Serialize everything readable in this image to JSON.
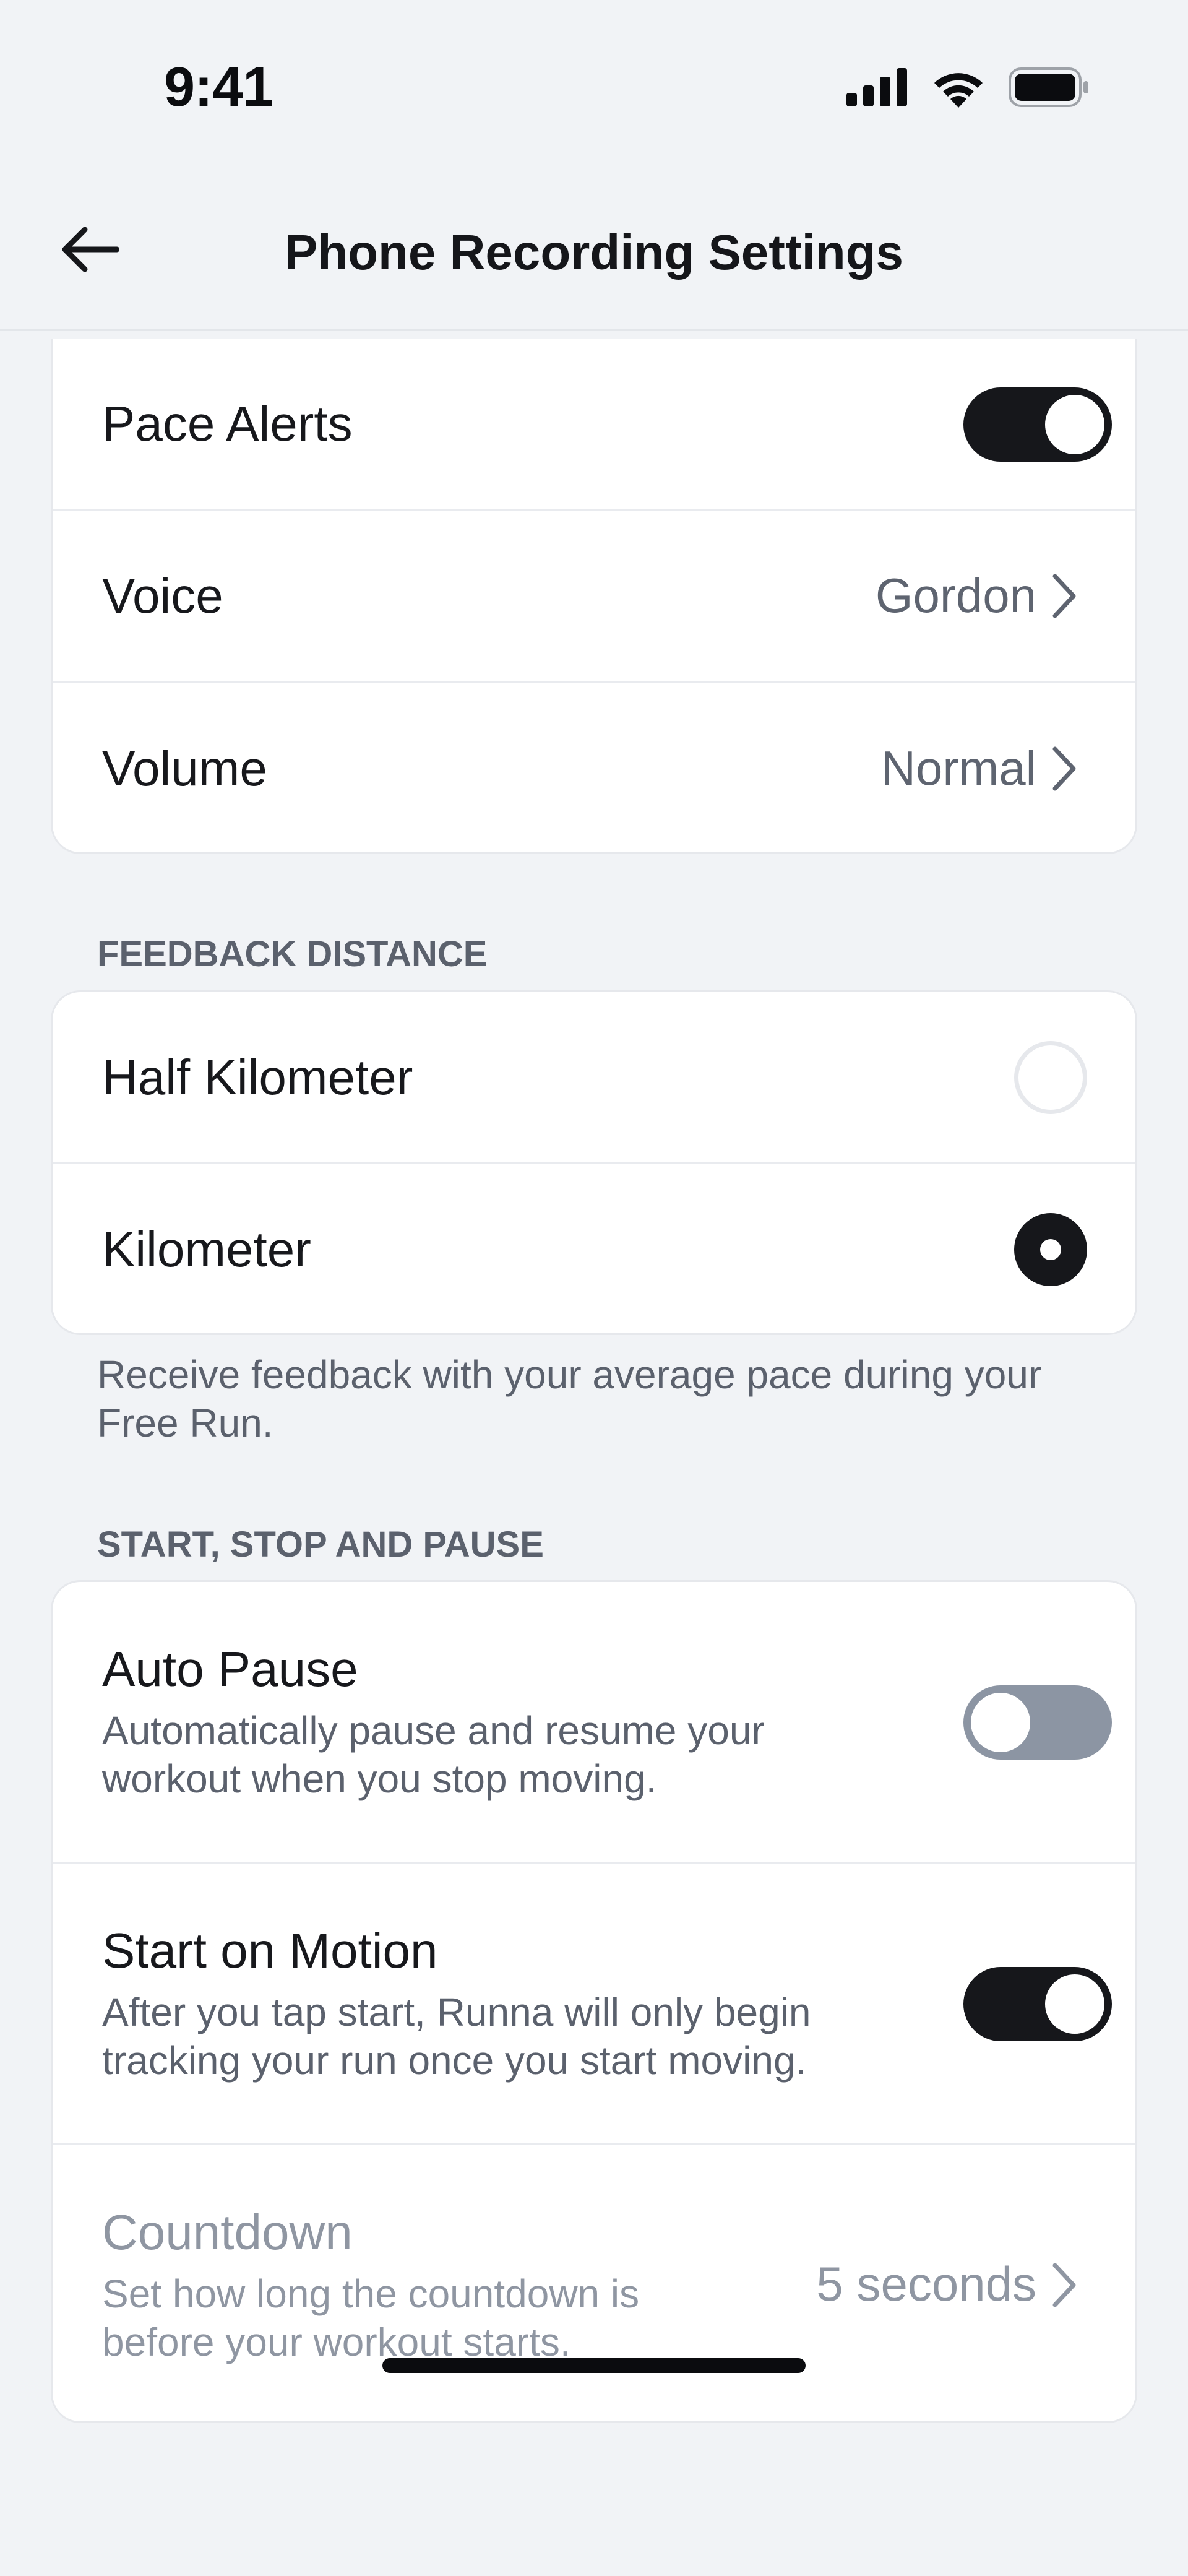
{
  "status_bar": {
    "time": "9:41"
  },
  "nav": {
    "title": "Phone Recording Settings"
  },
  "audio_card": {
    "pace_alerts": {
      "label": "Pace Alerts",
      "enabled": true
    },
    "voice": {
      "label": "Voice",
      "value": "Gordon"
    },
    "volume": {
      "label": "Volume",
      "value": "Normal"
    }
  },
  "feedback_distance": {
    "header": "FEEDBACK DISTANCE",
    "options": [
      {
        "label": "Half Kilometer",
        "selected": false
      },
      {
        "label": "Kilometer",
        "selected": true
      }
    ],
    "footnote": "Receive feedback with your average pace during your Free Run."
  },
  "start_stop_pause": {
    "header": "START, STOP AND PAUSE",
    "auto_pause": {
      "label": "Auto Pause",
      "description": "Automatically pause and resume your workout when you stop moving.",
      "enabled": false
    },
    "start_on_motion": {
      "label": "Start on Motion",
      "description": "After you tap start, Runna will only begin tracking your run once you start moving.",
      "enabled": true
    },
    "countdown": {
      "label": "Countdown",
      "description": "Set how long the countdown is before your workout starts.",
      "value": "5 seconds"
    }
  },
  "colors": {
    "background": "#f1f3f6",
    "card": "#ffffff",
    "toggle_on": "#16171b",
    "toggle_off": "#8c95a3",
    "secondary_text": "#5b616d",
    "disabled_text": "#8f96a2"
  }
}
